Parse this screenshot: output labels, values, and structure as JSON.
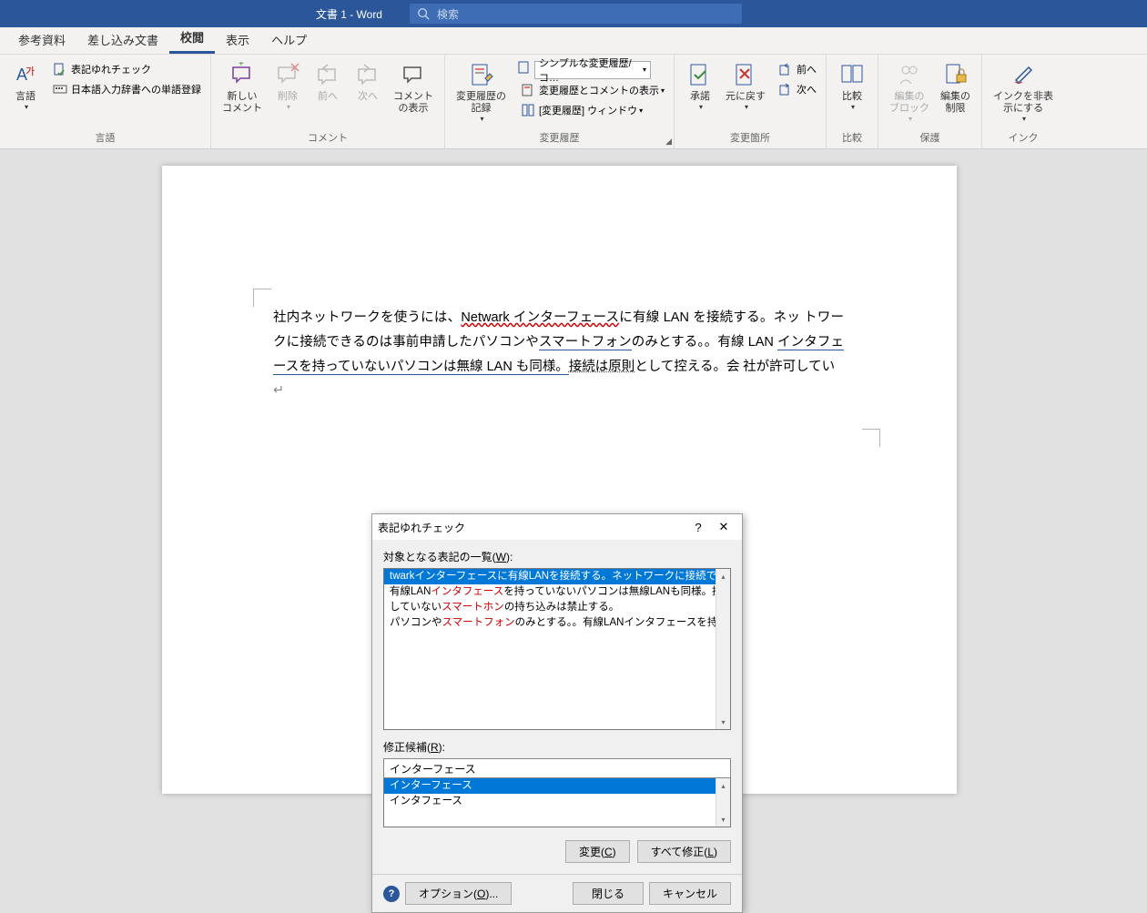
{
  "title": "文書 1 - Word",
  "search": {
    "placeholder": "検索"
  },
  "tabs": [
    "参考資料",
    "差し込み文書",
    "校閲",
    "表示",
    "ヘルプ"
  ],
  "active_tab": 2,
  "ribbon": {
    "lang": {
      "btn1": "表記ゆれチェック",
      "btn2": "日本語入力辞書への単語登録",
      "large": "言語",
      "group": "言語"
    },
    "comments": {
      "new": "新しい\nコメント",
      "del": "削除",
      "prev": "前へ",
      "next": "次へ",
      "show": "コメント\nの表示",
      "group": "コメント"
    },
    "tracking": {
      "track": "変更履歴の\n記録",
      "select_val": "シンプルな変更履歴/コ…",
      "show_markup": "変更履歴とコメントの表示",
      "review_pane": "[変更履歴] ウィンドウ",
      "group": "変更履歴"
    },
    "changes": {
      "accept": "承諾",
      "reject": "元に戻す",
      "prev": "前へ",
      "next": "次へ",
      "group": "変更箇所"
    },
    "compare": {
      "btn": "比較",
      "group": "比較"
    },
    "protect": {
      "block": "編集の\nブロック",
      "restrict": "編集の\n制限",
      "group": "保護"
    },
    "ink": {
      "btn": "インクを非表\n示にする",
      "group": "インク"
    }
  },
  "document": {
    "line1_a": "社内ネットワークを使うには、",
    "line1_b": "Netwark インターフェース",
    "line1_c": "に有線 LAN を接続する。ネッ",
    "line2_a": "トワークに接続できるのは事前申請したパソコンや",
    "line2_b": "スマートフォン",
    "line2_c": "のみとする。。有線  LAN ",
    "line3_a": "インタフェースを持っていないパソコンは無線 LAN も同様。",
    "line3_b": "接続は原則",
    "line3_c": "として控える。会",
    "line4": "社が許可してい"
  },
  "dialog": {
    "title": "表記ゆれチェック",
    "list_label_a": "対象となる表記の一覧(",
    "list_label_key": "W",
    "list_label_b": "):",
    "rows": [
      {
        "pre": "twark",
        "linked": "インターフェース",
        "post": "に有線LANを接続する。ネットワークに接続できるの",
        "sel": true
      },
      {
        "pre": "有線LAN",
        "linked": "インタフェース",
        "post": "を持っていないパソコンは無線LANも同様。接続は原",
        "sel": false
      },
      {
        "pre": "していない",
        "linked": "スマートホン",
        "post": "の持ち込みは禁止する。",
        "sel": false
      },
      {
        "pre": "パソコンや",
        "linked": "スマートフォン",
        "post": "のみとする。。有線LANインタフェースを持っていないパ",
        "sel": false
      }
    ],
    "fix_label_a": "修正候補(",
    "fix_label_key": "R",
    "fix_label_b": "):",
    "fix_value": "インターフェース",
    "fix_options": [
      "インターフェース",
      "インタフェース"
    ],
    "btn_change_a": "変更(",
    "btn_change_key": "C",
    "btn_change_b": ")",
    "btn_all_a": "すべて修正(",
    "btn_all_key": "L",
    "btn_all_b": ")",
    "btn_opt_a": "オプション(",
    "btn_opt_key": "O",
    "btn_opt_b": ")...",
    "btn_close": "閉じる",
    "btn_cancel": "キャンセル"
  }
}
